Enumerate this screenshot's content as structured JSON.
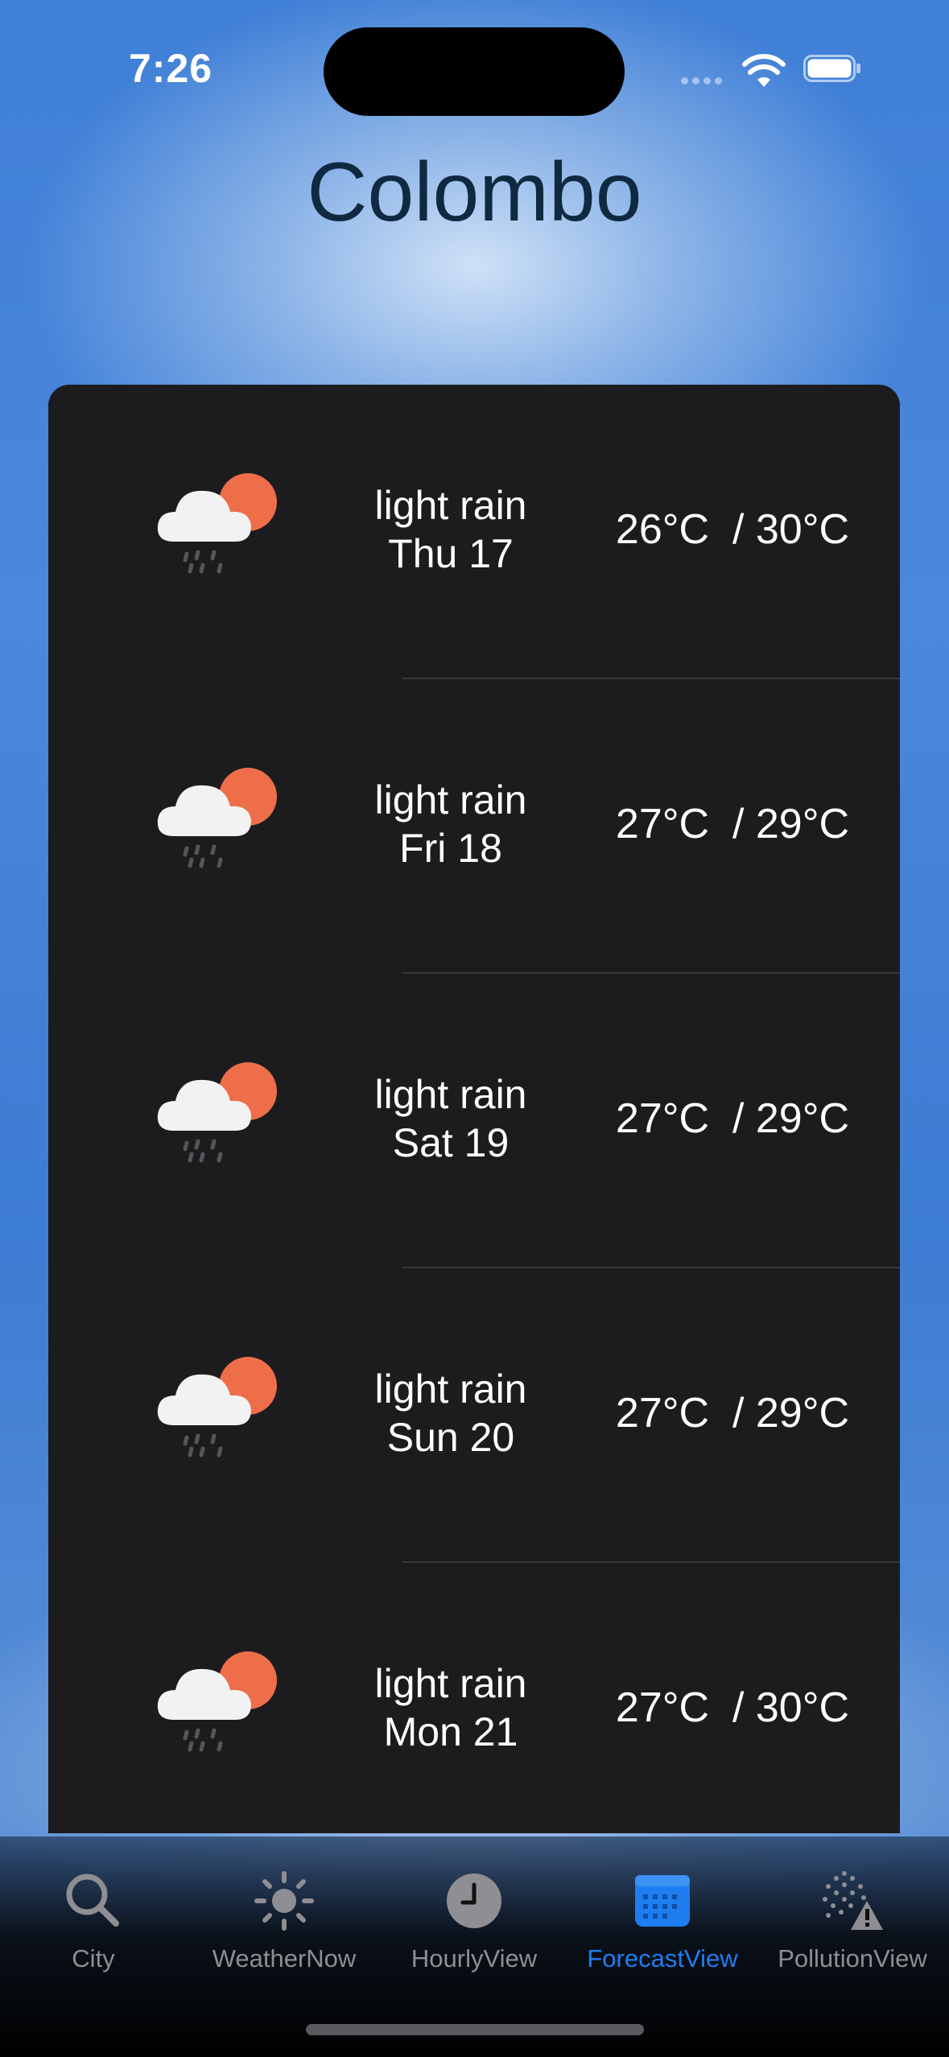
{
  "status_bar": {
    "time": "7:26"
  },
  "city": {
    "name": "Colombo"
  },
  "forecast": [
    {
      "icon": "light-rain-icon",
      "condition": "light rain",
      "day": "Thu  17",
      "temp": "26°C  / 30°C"
    },
    {
      "icon": "light-rain-icon",
      "condition": "light rain",
      "day": "Fri  18",
      "temp": "27°C  / 29°C"
    },
    {
      "icon": "light-rain-icon",
      "condition": "light rain",
      "day": "Sat  19",
      "temp": "27°C  / 29°C"
    },
    {
      "icon": "light-rain-icon",
      "condition": "light rain",
      "day": "Sun  20",
      "temp": "27°C  / 29°C"
    },
    {
      "icon": "light-rain-icon",
      "condition": "light rain",
      "day": "Mon  21",
      "temp": "27°C  / 30°C"
    }
  ],
  "tabs": [
    {
      "label": "City",
      "icon": "search-icon",
      "active": false
    },
    {
      "label": "WeatherNow",
      "icon": "sun-icon",
      "active": false
    },
    {
      "label": "HourlyView",
      "icon": "clock-icon",
      "active": false
    },
    {
      "label": "ForecastView",
      "icon": "calendar-icon",
      "active": true
    },
    {
      "label": "PollutionView",
      "icon": "pollution-warning-icon",
      "active": false
    }
  ],
  "colors": {
    "accent": "#1e7ef0",
    "card": "#1c1c1e",
    "title": "#0f2a40",
    "sun": "#ee6e4a"
  }
}
